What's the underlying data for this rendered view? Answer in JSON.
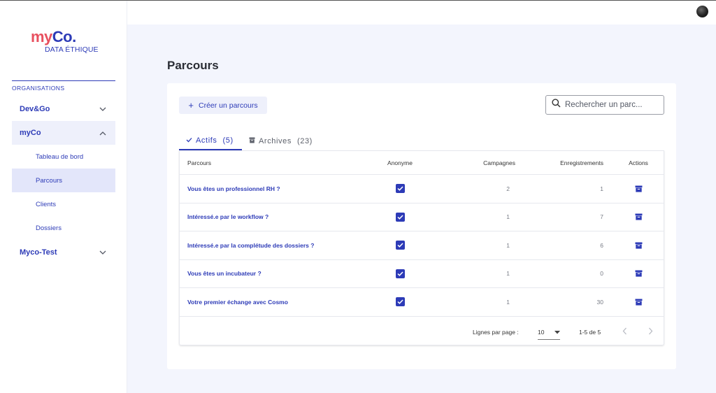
{
  "brand": {
    "name_part1": "my",
    "name_part2": "Co.",
    "subtitle": "DATA ÉTHIQUE"
  },
  "sidebar": {
    "section_label": "ORGANISATIONS",
    "organisations": [
      {
        "label": "Dev&Go",
        "expanded": false
      },
      {
        "label": "myCo",
        "expanded": true,
        "children": [
          {
            "label": "Tableau de bord",
            "active": false
          },
          {
            "label": "Parcours",
            "active": true
          },
          {
            "label": "Clients",
            "active": false
          },
          {
            "label": "Dossiers",
            "active": false
          }
        ]
      },
      {
        "label": "Myco-Test",
        "expanded": false
      }
    ]
  },
  "header": {
    "avatar_icon": "user-avatar"
  },
  "page": {
    "title": "Parcours"
  },
  "toolbar": {
    "create_label": "Créer un parcours",
    "search_placeholder": "Rechercher un parc..."
  },
  "tabs": [
    {
      "label": "Actifs",
      "count": "(5)",
      "active": true,
      "icon": "check-icon"
    },
    {
      "label": "Archives",
      "count": "(23)",
      "active": false,
      "icon": "archive-icon"
    }
  ],
  "table": {
    "columns": [
      "Parcours",
      "Anonyme",
      "Campagnes",
      "Enregistrements",
      "Actions"
    ],
    "rows": [
      {
        "name": "Vous êtes un professionnel RH ?",
        "anonyme": true,
        "campagnes": "2",
        "enregistrements": "1"
      },
      {
        "name": "Intéressé.e par le workflow ?",
        "anonyme": true,
        "campagnes": "1",
        "enregistrements": "7"
      },
      {
        "name": "Intéressé.e par la complétude des dossiers ?",
        "anonyme": true,
        "campagnes": "1",
        "enregistrements": "6"
      },
      {
        "name": "Vous êtes un incubateur ?",
        "anonyme": true,
        "campagnes": "1",
        "enregistrements": "0"
      },
      {
        "name": "Votre premier échange avec Cosmo",
        "anonyme": true,
        "campagnes": "1",
        "enregistrements": "30"
      }
    ]
  },
  "pagination": {
    "rows_per_page_label": "Lignes par page :",
    "rows_per_page": "10",
    "range": "1-5 de 5"
  },
  "colors": {
    "accent": "#2d3bb7",
    "brand_red": "#e8505f",
    "background": "#f3f5fd"
  }
}
